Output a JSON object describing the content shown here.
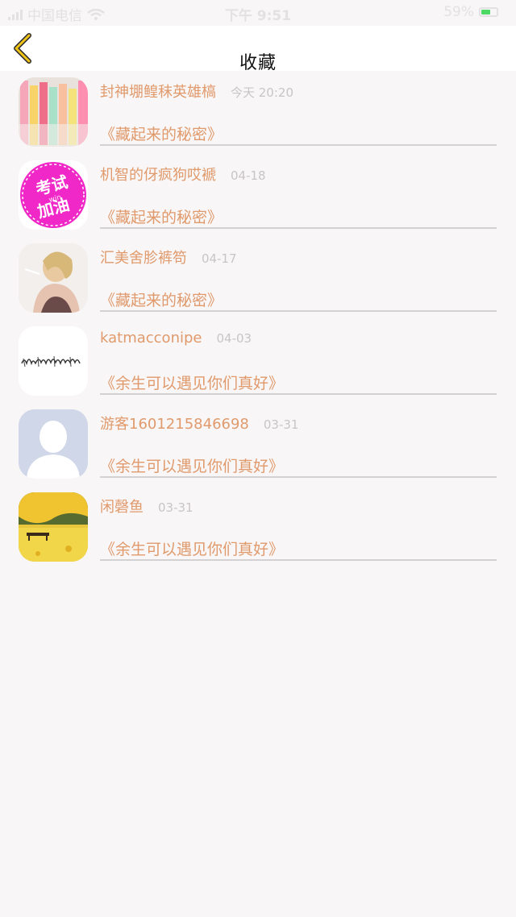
{
  "status_bar": {
    "carrier": "中国电信",
    "time": "下午 9:51",
    "battery": "59%"
  },
  "header": {
    "title": "收藏"
  },
  "favorites": [
    {
      "username": "封神堋鳇秣英雄槁",
      "date": "今天 20:20",
      "title": "《藏起来的秘密》",
      "avatar": "stationery-photo"
    },
    {
      "username": "机智的伢疯狗哎褫",
      "date": "04-18",
      "title": "《藏起来的秘密》",
      "avatar": "exam-cheer-badge",
      "avatar_text": [
        "考试",
        "加油",
        "win"
      ]
    },
    {
      "username": "汇美舍胗裤笱",
      "date": "04-17",
      "title": "《藏起来的秘密》",
      "avatar": "portrait-photo"
    },
    {
      "username": "katmacconipe",
      "date": "04-03",
      "title": "《余生可以遇见你们真好》",
      "avatar": "handwriting-image"
    },
    {
      "username": "游客1601215846698",
      "date": "03-31",
      "title": "《余生可以遇见你们真好》",
      "avatar": "default-user"
    },
    {
      "username": "闲磬鱼",
      "date": "03-31",
      "title": "《余生可以遇见你们真好》",
      "avatar": "autumn-bench-photo"
    }
  ],
  "colors": {
    "accent": "#e09a6c",
    "date": "#c8c5c6",
    "back_icon": "#f0c419",
    "background": "#f8f6f7"
  }
}
